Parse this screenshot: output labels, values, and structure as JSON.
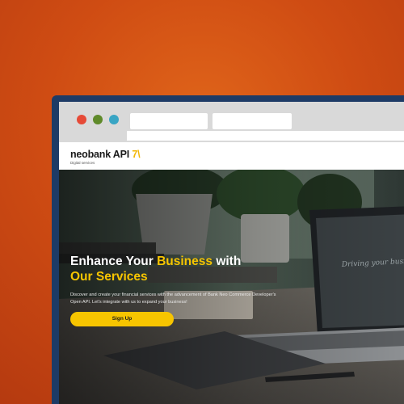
{
  "brand": {
    "name": "neobank API",
    "mark": "7\\",
    "tagline": "Digital services"
  },
  "hero": {
    "title_part1": "Enhance Your ",
    "title_highlight": "Business",
    "title_part2": " with",
    "title_line2": "Our Services",
    "description": "Discover and create your financial services with the advancement of Bank Neo Commerce Developer's Open API. Let's integrate with us to expand your business!",
    "cta_label": "Sign Up",
    "laptop_screen_text": "Driving your business"
  },
  "colors": {
    "accent": "#f7c500",
    "background": "#cf4c13",
    "frame": "#1d3b66"
  }
}
